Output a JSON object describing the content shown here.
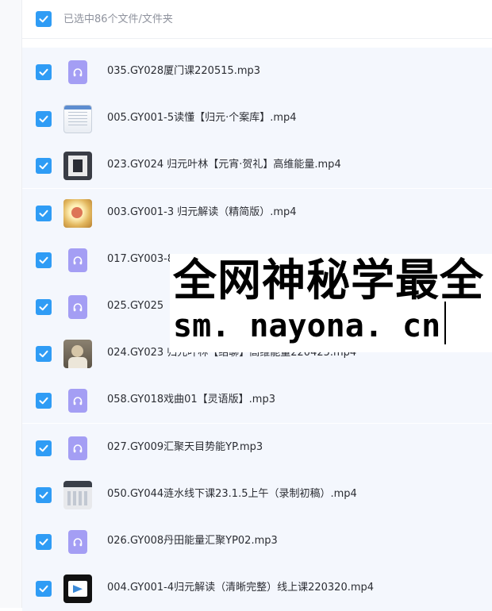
{
  "header": {
    "selection_text": "已选中86个文件/文件夹"
  },
  "files": [
    {
      "name": "035.GY028厦门课220515.mp3",
      "thumb": "audio"
    },
    {
      "name": "005.GY001-5读懂【归元·个案库】.mp4",
      "thumb": "doc"
    },
    {
      "name": "023.GY024 归元叶林【元宵·贺礼】高维能量.mp4",
      "thumb": "dark"
    },
    {
      "name": "003.GY001-3 归元解读（精简版）.mp4",
      "thumb": "gold"
    },
    {
      "name": "017.GY003-8",
      "thumb": "audio"
    },
    {
      "name": "025.GY025",
      "thumb": "audio"
    },
    {
      "name": "024.GY023 归元叶林【结聊】高维能量220425.mp4",
      "thumb": "people"
    },
    {
      "name": "058.GY018戏曲01【灵语版】.mp3",
      "thumb": "audio"
    },
    {
      "name": "027.GY009汇聚天目势能YP.mp3",
      "thumb": "audio"
    },
    {
      "name": "050.GY044涟水线下课23.1.5上午（录制初稿）.mp4",
      "thumb": "screen"
    },
    {
      "name": "026.GY008丹田能量汇聚YP02.mp3",
      "thumb": "audio"
    },
    {
      "name": "004.GY001-4归元解读（清晰完整）线上课220320.mp4",
      "thumb": "video"
    }
  ],
  "watermark": {
    "line1": "全网神秘学最全",
    "line2": "sm. nayona. cn"
  },
  "colors": {
    "checkbox": "#2f9cf5",
    "audio_icon": "#a49ef4",
    "row_background": "#f4f7fd"
  }
}
